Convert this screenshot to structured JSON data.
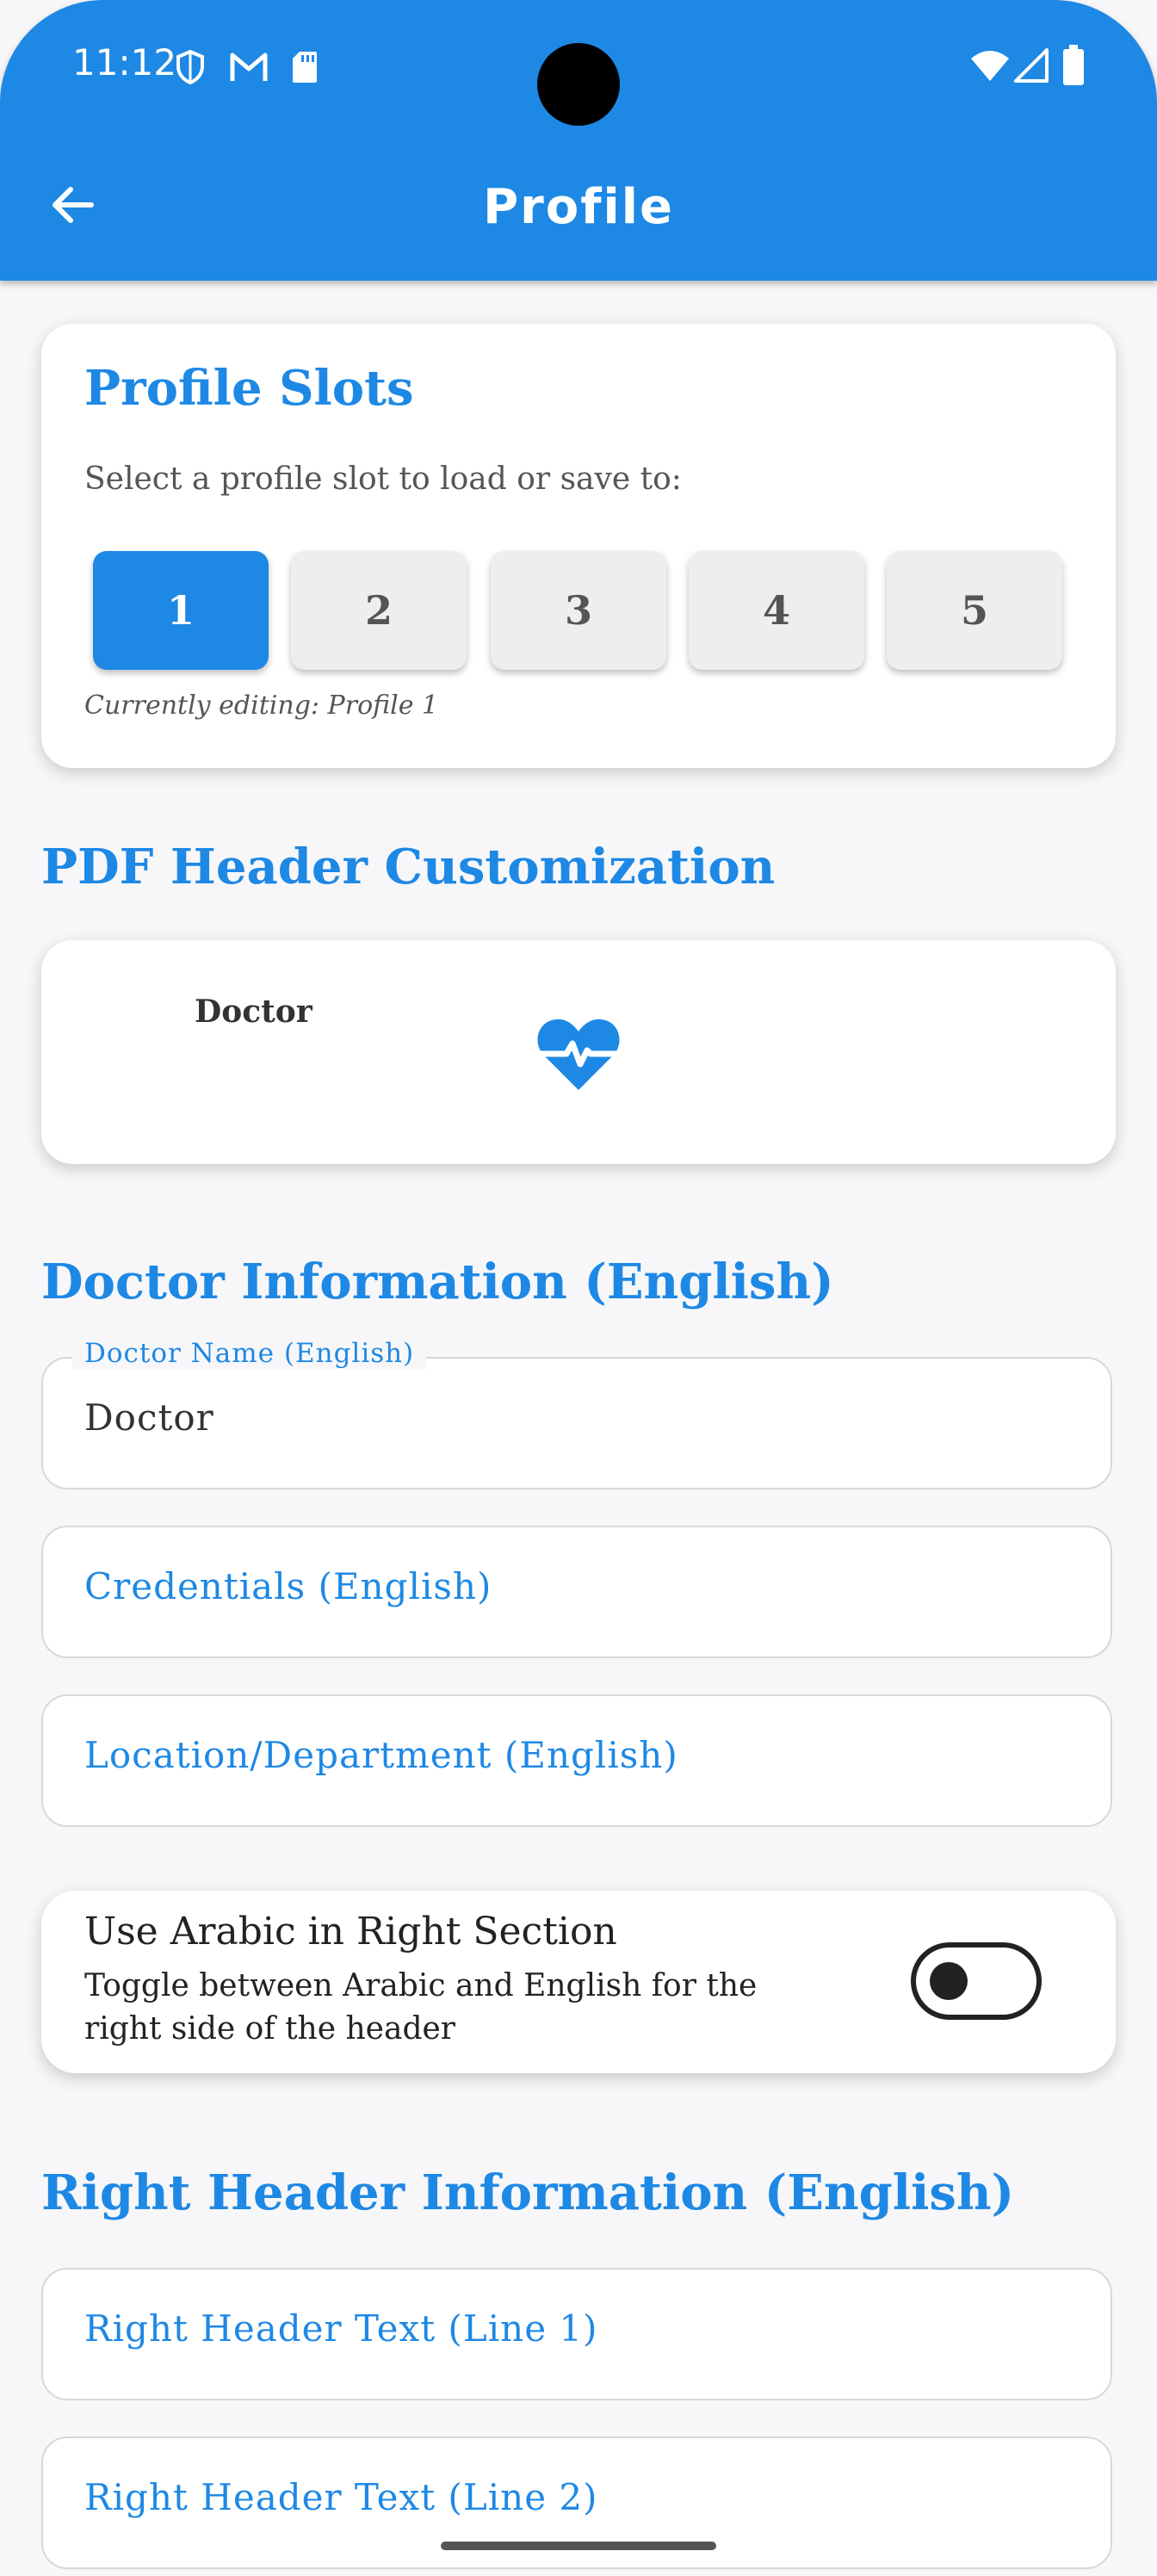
{
  "status_bar": {
    "time": "11:12",
    "left_icons": [
      "shield-icon",
      "gmail-icon",
      "sd-card-icon"
    ],
    "right_icons": [
      "wifi-icon",
      "signal-icon",
      "battery-icon"
    ]
  },
  "app_bar": {
    "title": "Profile",
    "back_icon": "arrow-back-icon"
  },
  "profile_slots": {
    "title": "Profile Slots",
    "description": "Select a profile slot to load or save to:",
    "slots": [
      "1",
      "2",
      "3",
      "4",
      "5"
    ],
    "selected": "1",
    "editing_text": "Currently editing: Profile 1"
  },
  "pdf_header": {
    "section_title": "PDF Header Customization",
    "preview_name": "Doctor",
    "preview_icon": "heart-pulse-icon"
  },
  "doctor_info": {
    "section_title": "Doctor Information (English)",
    "name_label": "Doctor Name (English)",
    "name_value": "Doctor",
    "credentials_placeholder": "Credentials (English)",
    "location_placeholder": "Location/Department (English)"
  },
  "arabic_toggle": {
    "title": "Use Arabic in Right Section",
    "description": "Toggle between Arabic and English for the right side of the header",
    "enabled": false
  },
  "right_header": {
    "section_title": "Right Header Information (English)",
    "line1_placeholder": "Right Header Text (Line 1)",
    "line2_placeholder": "Right Header Text (Line 2)"
  },
  "colors": {
    "primary": "#1e88e5",
    "background": "#f7f7f9"
  }
}
